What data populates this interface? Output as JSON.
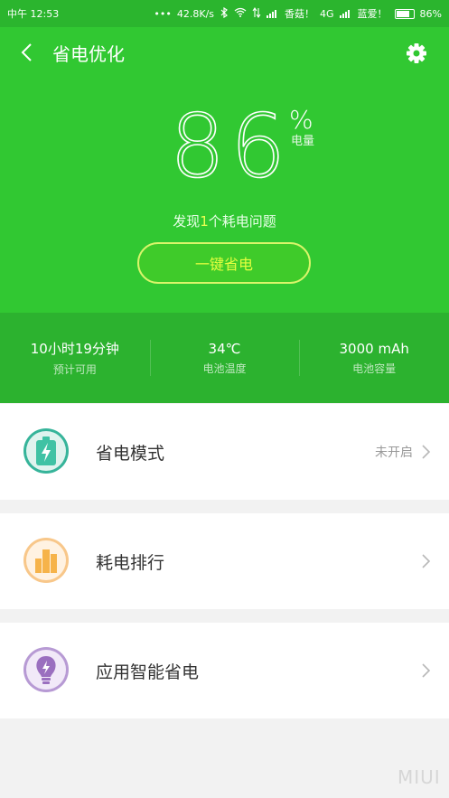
{
  "status_bar": {
    "time": "中午 12:53",
    "dots": "•••",
    "net_speed": "42.8K/s",
    "carrier1": "香菇！",
    "network_type": "4G",
    "carrier2": "蓝爱！",
    "battery": "86%"
  },
  "header": {
    "title": "省电优化",
    "level_value": "86",
    "level_unit": "%",
    "level_label": "电量",
    "issues_prefix": "发现",
    "issues_count": "1",
    "issues_suffix": "个耗电问题",
    "optimize_button": "一键省电"
  },
  "stats": [
    {
      "value": "10小时19分钟",
      "label": "预计可用"
    },
    {
      "value": "34℃",
      "label": "电池温度"
    },
    {
      "value": "3000 mAh",
      "label": "电池容量"
    }
  ],
  "cards": [
    {
      "label": "省电模式",
      "status": "未开启"
    },
    {
      "label": "耗电排行",
      "status": ""
    },
    {
      "label": "应用智能省电",
      "status": ""
    }
  ],
  "watermark": "MIUI",
  "colors": {
    "brand_green": "#31c832",
    "stats_green": "#2cb22f",
    "button_text": "#e6ff3f",
    "mode_icon": "#36b49a",
    "rank_icon": "#f6b34a",
    "smart_icon": "#9a6fbf"
  },
  "battery_level_fraction": 0.86
}
